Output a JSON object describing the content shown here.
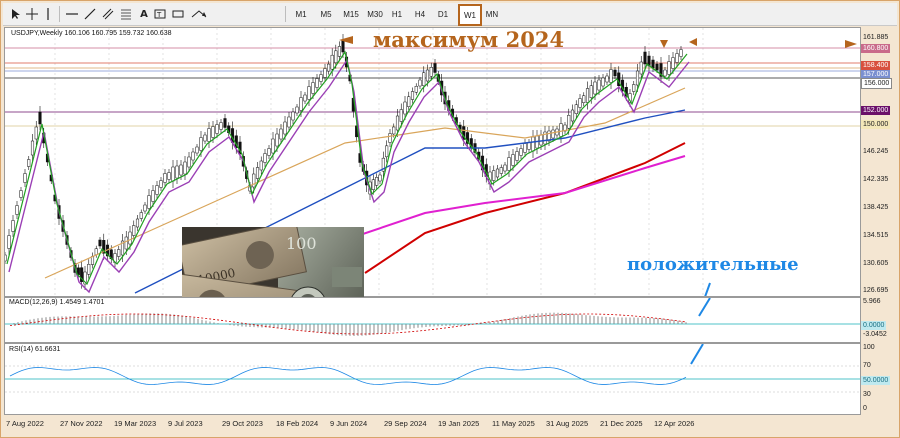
{
  "toolbar": {
    "tools": [
      "cursor-icon",
      "crosshair-icon",
      "vertical-line-icon",
      "horizontal-line-icon",
      "trendline-icon",
      "channel-icon",
      "fibonacci-icon",
      "text-icon",
      "label-icon",
      "rectangle-icon",
      "arrow-icon"
    ],
    "timeframes": [
      "M1",
      "M5",
      "M15",
      "M30",
      "H1",
      "H4",
      "D1",
      "W1",
      "MN"
    ],
    "active_timeframe": "W1"
  },
  "chart": {
    "symbol_line": "USDJPY,Weekly  160.106 160.795 159.732 160.638",
    "annotation_max": "максимум 2024",
    "annotation_positive": "положительные",
    "price_axis": [
      "161.885",
      "146.245",
      "142.335",
      "138.425",
      "134.515",
      "130.605",
      "126.695"
    ],
    "price_boxes": [
      {
        "text": "160.800",
        "bg": "#c96a8a",
        "fg": "#ffffff"
      },
      {
        "text": "158.400",
        "bg": "#d8503e",
        "fg": "#ffffff"
      },
      {
        "text": "157.000",
        "bg": "#7a8fd0",
        "fg": "#ffffff"
      },
      {
        "text": "156.000",
        "bg": "#ffffff",
        "fg": "#222222"
      },
      {
        "text": "152.000",
        "bg": "#6a0f6a",
        "fg": "#ffffff"
      },
      {
        "text": "150.000",
        "bg": "#f3e7b8",
        "fg": "#222222"
      }
    ],
    "dates": [
      "7 Aug 2022",
      "27 Nov 2022",
      "19 Mar 2023",
      "9 Jul 2023",
      "29 Oct 2023",
      "18 Feb 2024",
      "9 Jun 2024",
      "29 Sep 2024",
      "19 Jan 2025",
      "11 May 2025",
      "31 Aug 2025",
      "21 Dec 2025",
      "12 Apr 2026"
    ]
  },
  "macd": {
    "title": "MACD(12,26,9) 1.4549 1.4701",
    "axis": [
      "5.966",
      "0.0000",
      "-3.0452"
    ]
  },
  "rsi": {
    "title": "RSI(14) 61.6631",
    "axis": [
      "100",
      "70",
      "50.0000",
      "30",
      "0"
    ]
  },
  "colors": {
    "accent_brown": "#b5651d",
    "annotation_blue": "#1e88e5",
    "ma_red": "#d00000",
    "ma_magenta": "#e020d0",
    "ma_blue": "#2050c0",
    "ma_purple": "#9b3fb5",
    "ma_green": "#20a020",
    "ma_tan": "#d9a55a"
  }
}
